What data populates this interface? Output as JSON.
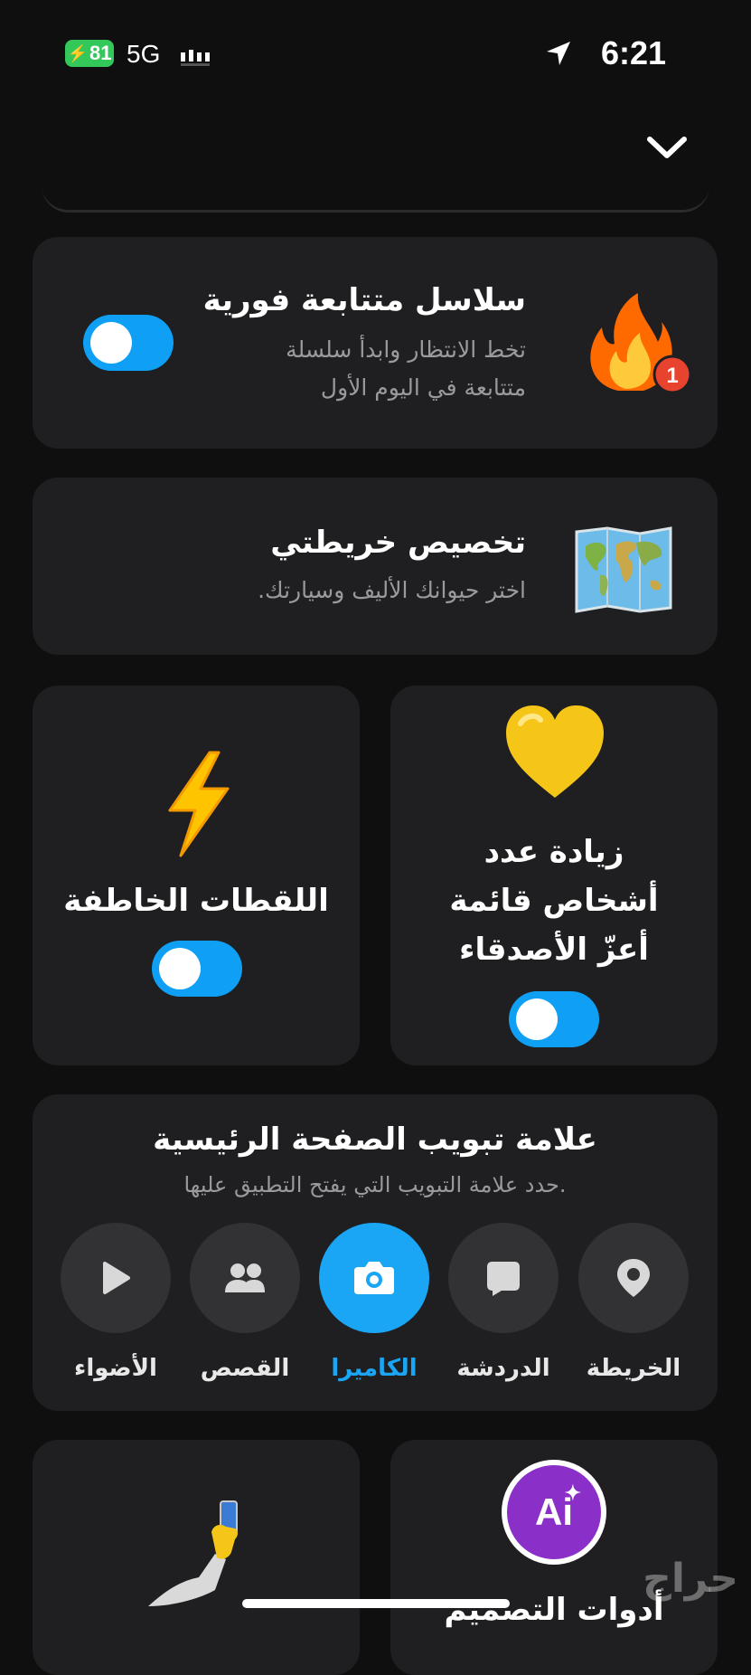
{
  "status": {
    "battery": "81",
    "network": "5G",
    "time": "6:21"
  },
  "streaks": {
    "title": "سلاسل متتابعة فورية",
    "desc_line1": "تخط الانتظار وابدأ سلسلة",
    "desc_line2": "متتابعة في اليوم الأول",
    "badge": "1",
    "toggle_on": true
  },
  "map": {
    "title": "تخصيص خريطتي",
    "desc": "اختر حيوانك الأليف وسيارتك."
  },
  "best_friends": {
    "line1": "زيادة عدد",
    "line2": "أشخاص قائمة",
    "line3": "أعزّ الأصدقاء",
    "toggle_on": true
  },
  "snaps": {
    "title": "اللقطات الخاطفة",
    "toggle_on": true
  },
  "home_tab": {
    "title": "علامة تبويب الصفحة الرئيسية",
    "desc": "حدد علامة التبويب التي يفتح التطبيق عليها.",
    "tabs": [
      {
        "label": "الخريطة",
        "icon": "map-pin-icon"
      },
      {
        "label": "الدردشة",
        "icon": "chat-icon"
      },
      {
        "label": "الكاميرا",
        "icon": "camera-icon",
        "active": true
      },
      {
        "label": "القصص",
        "icon": "people-icon"
      },
      {
        "label": "الأضواء",
        "icon": "play-icon"
      }
    ]
  },
  "bottom": {
    "ai_badge": "Ai",
    "design_tools": "أدوات التصميم"
  },
  "watermark": "حراج",
  "colors": {
    "accent": "#1aa6f5",
    "card": "#1f1f21",
    "background": "#0f0f10"
  }
}
